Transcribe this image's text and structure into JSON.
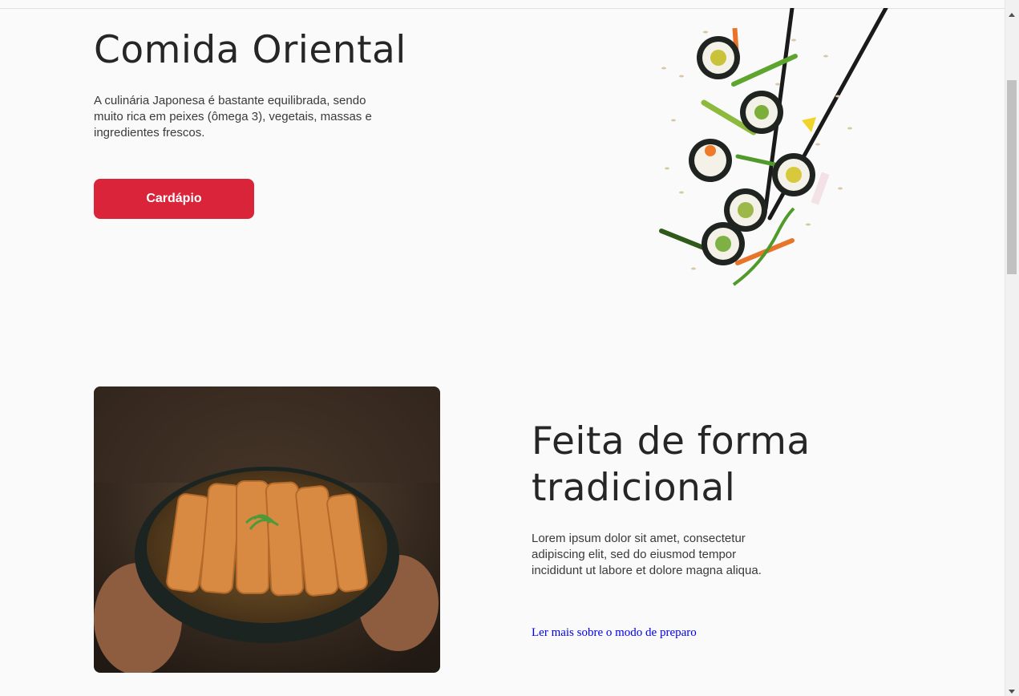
{
  "hero": {
    "title": "Comida Oriental",
    "description": "A culinária Japonesa é bastante equilibrada, sendo muito rica em peixes (ômega 3), vegetais, massas e ingredientes frescos.",
    "cta_label": "Cardápio"
  },
  "section": {
    "title": "Feita de forma tradicional",
    "description": "Lorem ipsum dolor sit amet, consectetur adipiscing elit, sed do eiusmod tempor incididunt ut labore et dolore magna aliqua.",
    "link_label": "Ler mais sobre o modo de preparo"
  },
  "colors": {
    "accent": "#d9243a",
    "background": "#fafafa",
    "link": "#0000ee"
  }
}
